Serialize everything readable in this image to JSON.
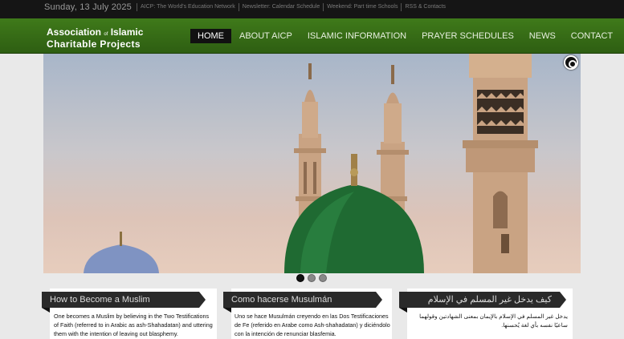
{
  "topbar": {
    "date": "Sunday, 13 July 2025",
    "links": [
      "AICP: The World's Education Network",
      "Newsletter: Calendar Schedule",
      "Weekend: Part time Schools",
      "RSS & Contacts"
    ]
  },
  "logo": {
    "line1_a": "Association",
    "line1_small": "of",
    "line1_b": "Islamic",
    "line2": "Charitable Projects"
  },
  "nav": {
    "items": [
      "HOME",
      "ABOUT AICP",
      "ISLAMIC INFORMATION",
      "PRAYER SCHEDULES",
      "NEWS",
      "CONTACT"
    ]
  },
  "slider": {
    "pause_label": "pause-slideshow"
  },
  "cards": [
    {
      "title": "How to Become a Muslim",
      "text": "One becomes a Muslim by believing in the Two Testifications of Faith (referred to in Arabic as ash-Shahadatan) and uttering them with the intention of leaving out blasphemy."
    },
    {
      "title": "Como hacerse Musulmán",
      "text": "Uno se hace Musulmán creyendo en las Dos Testificaciones de Fe (referido en Arabe como Ash-shahadatan) y diciéndolo con la intención de renunciar blasfemia."
    },
    {
      "title": "كيف يدخل غير المسلم في الإسلام",
      "text": "يدخل غير المسلم في الإسلام بالإيمان بمعنى الشهادتين وقولهما ساعيًا نفسه بأي لغة يُحسنها."
    }
  ],
  "colors": {
    "nav_green": "#3f7a1a",
    "topbar": "#151515",
    "dome_green": "#1f6a32"
  }
}
